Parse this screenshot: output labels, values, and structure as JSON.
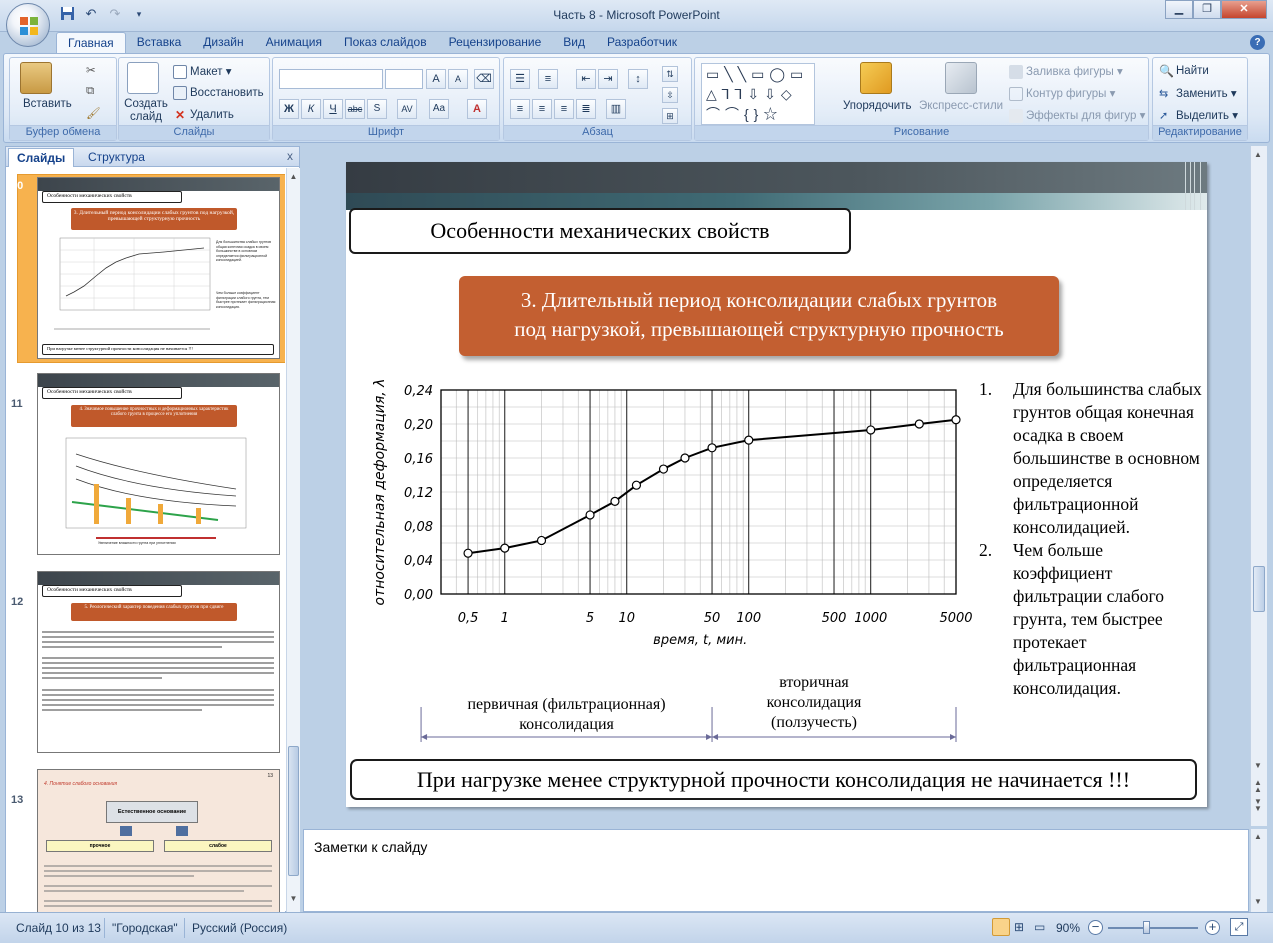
{
  "window": {
    "title": "Часть 8 - Microsoft PowerPoint"
  },
  "quick_access": [
    "save-icon",
    "undo-icon",
    "redo-icon",
    "customize-icon"
  ],
  "tabs": [
    "Главная",
    "Вставка",
    "Дизайн",
    "Анимация",
    "Показ слайдов",
    "Рецензирование",
    "Вид",
    "Разработчик"
  ],
  "ribbon": {
    "clipboard": {
      "label": "Буфер обмена",
      "paste": "Вставить"
    },
    "slides": {
      "label": "Слайды",
      "new_slide": "Создать слайд",
      "layout": "Макет",
      "reset": "Восстановить",
      "delete": "Удалить"
    },
    "font": {
      "label": "Шрифт",
      "font_name": "",
      "font_size": ""
    },
    "paragraph": {
      "label": "Абзац"
    },
    "drawing": {
      "label": "Рисование",
      "arrange": "Упорядочить",
      "quick_styles": "Экспресс-стили",
      "fill": "Заливка фигуры",
      "outline": "Контур фигуры",
      "effects": "Эффекты для фигур"
    },
    "editing": {
      "label": "Редактирование",
      "find": "Найти",
      "replace": "Заменить",
      "select": "Выделить"
    }
  },
  "left_pane": {
    "tab_slides": "Слайды",
    "tab_outline": "Структура",
    "close": "x",
    "thumbnails": [
      {
        "number": "10",
        "title": "Особенности механических свойств",
        "subtitle": "3. Длительный период консолидации слабых грунтов под нагрузкой, превышающей структурную прочность",
        "footer": "При нагрузке менее структурной прочности консолидация не начинается !!!"
      },
      {
        "number": "11",
        "title": "Особенности механических свойств",
        "subtitle": "4. Значимое повышение прочностных и деформационных характеристик слабого грунта в процессе его уплотнения",
        "footer": "Увеличение влажности грунта при уплотнении"
      },
      {
        "number": "12",
        "title": "Особенности механических свойств",
        "subtitle": "5. Реологический характер поведения слабых грунтов при сдвиге"
      },
      {
        "number": "13",
        "title": "4. Понятие слабого основания",
        "page": "13",
        "box1": "Естественное основание",
        "box2": "прочное",
        "box3": "слабое"
      }
    ]
  },
  "slide": {
    "title": "Особенности механических свойств",
    "subtitle_line1": "3. Длительный период консолидации слабых грунтов",
    "subtitle_line2": "под нагрузкой, превышающей структурную прочность",
    "list": [
      {
        "num": "1.",
        "text": "Для большинства слабых грунтов общая конечная осадка в своем большинстве в основном определяется фильтрационной консолидацией."
      },
      {
        "num": "2.",
        "text": "Чем больше коэффициент фильтрации слабого грунта, тем быстрее протекает фильтрационная консолидация."
      }
    ],
    "bottom_note": "При нагрузке менее структурной прочности консолидация не начинается !!!"
  },
  "chart_data": {
    "type": "line",
    "ylabel": "относительная деформация, λ",
    "xlabel": "время, t, мин.",
    "x_scale": "log",
    "x_ticks": [
      "0,5",
      "1",
      "5",
      "10",
      "50",
      "100",
      "500",
      "1000",
      "5000"
    ],
    "x_tick_values": [
      0.5,
      1,
      5,
      10,
      50,
      100,
      500,
      1000,
      5000
    ],
    "y_ticks": [
      "0,00",
      "0,04",
      "0,08",
      "0,12",
      "0,16",
      "0,20",
      "0,24"
    ],
    "ylim": [
      0,
      0.24
    ],
    "grid": true,
    "series": [
      {
        "x": [
          0.5,
          1,
          2,
          5,
          8,
          12,
          20,
          30,
          50,
          100,
          1000,
          2500,
          5000
        ],
        "y": [
          0.048,
          0.054,
          0.063,
          0.093,
          0.109,
          0.128,
          0.147,
          0.16,
          0.172,
          0.181,
          0.193,
          0.2,
          0.205
        ]
      }
    ],
    "annotations": {
      "primary": [
        "первичная (фильтрационная)",
        "консолидация"
      ],
      "secondary": [
        "вторичная",
        "консолидация",
        "(ползучесть)"
      ]
    }
  },
  "notes": {
    "placeholder": "Заметки к слайду"
  },
  "status": {
    "slide": "Слайд 10 из 13",
    "theme": "\"Городская\"",
    "language": "Русский (Россия)",
    "zoom": "90%"
  }
}
